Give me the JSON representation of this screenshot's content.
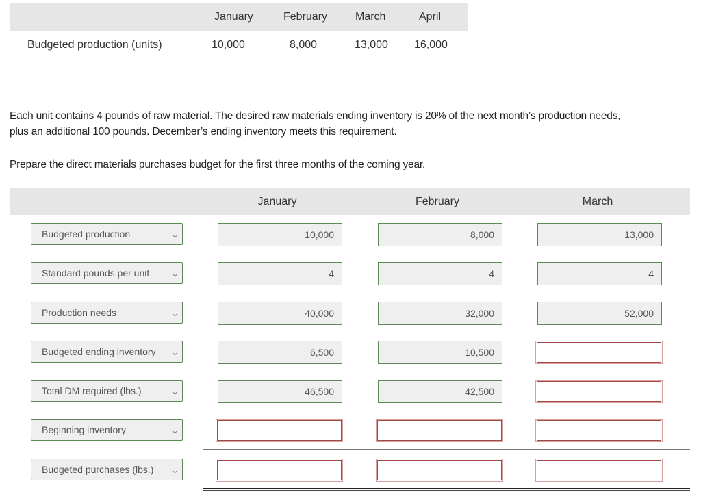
{
  "given_table": {
    "months": [
      "January",
      "February",
      "March",
      "April"
    ],
    "row_label": "Budgeted production (units)",
    "values": [
      "10,000",
      "8,000",
      "13,000",
      "16,000"
    ]
  },
  "instructions": {
    "line1": "Each unit contains 4 pounds of raw material. The desired raw materials ending inventory is 20% of the next month’s production needs,",
    "line2": "plus an additional 100 pounds. December’s ending inventory meets this requirement.",
    "prompt": "Prepare the direct materials purchases budget for the first three months of the coming year."
  },
  "budget": {
    "months": [
      "January",
      "February",
      "March"
    ],
    "rows": [
      {
        "label": "Budgeted production",
        "values": [
          "10,000",
          "8,000",
          "13,000"
        ]
      },
      {
        "label": "Standard pounds per unit",
        "values": [
          "4",
          "4",
          "4"
        ]
      },
      {
        "label": "Production needs",
        "values": [
          "40,000",
          "32,000",
          "52,000"
        ]
      },
      {
        "label": "Budgeted ending inventory",
        "values": [
          "6,500",
          "10,500",
          ""
        ]
      },
      {
        "label": "Total DM required (lbs.)",
        "values": [
          "46,500",
          "42,500",
          ""
        ]
      },
      {
        "label": "Beginning inventory",
        "values": [
          "",
          "",
          ""
        ]
      },
      {
        "label": "Budgeted purchases (lbs.)",
        "values": [
          "",
          "",
          ""
        ]
      }
    ]
  },
  "colors": {
    "correct_border": "#5c8a55",
    "error_border": "#a04848",
    "header_bg": "#e6e6e6"
  }
}
